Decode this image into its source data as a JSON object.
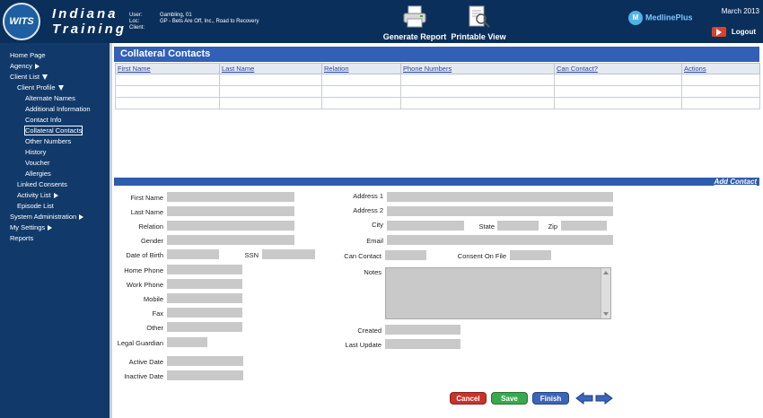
{
  "header": {
    "logo_text": "WITS",
    "brand_line1": "Indiana",
    "brand_line2": "Training",
    "info": [
      {
        "label": "User:",
        "value": "Gambling, 01"
      },
      {
        "label": "Loc:",
        "value": "GP - Bets Are Off, Inc., Road to Recovery"
      },
      {
        "label": "Client:",
        "value": ""
      }
    ],
    "generate_report_label": "Generate Report",
    "printable_view_label": "Printable View",
    "medline_label": "MedlinePlus",
    "date": "March 2013",
    "logout_label": "Logout"
  },
  "sidebar": {
    "items": [
      {
        "label": "Home Page"
      },
      {
        "label": "Agency"
      },
      {
        "label": "Client List"
      },
      {
        "label": "Client Profile"
      },
      {
        "label": "Alternate Names"
      },
      {
        "label": "Additional Information"
      },
      {
        "label": "Contact Info"
      },
      {
        "label": "Collateral Contacts"
      },
      {
        "label": "Other Numbers"
      },
      {
        "label": "History"
      },
      {
        "label": "Voucher"
      },
      {
        "label": "Allergies"
      },
      {
        "label": "Linked Consents"
      },
      {
        "label": "Activity List"
      },
      {
        "label": "Episode List"
      },
      {
        "label": "System Administration"
      },
      {
        "label": "My Settings"
      },
      {
        "label": "Reports"
      }
    ]
  },
  "main": {
    "title": "Collateral Contacts",
    "columns": [
      "First Name",
      "Last Name",
      "Relation",
      "Phone Numbers",
      "Can Contact?",
      "Actions"
    ],
    "add_contact_label": "Add Contact",
    "form": {
      "first_name": "First Name",
      "last_name": "Last Name",
      "relation": "Relation",
      "gender": "Gender",
      "dob": "Date of Birth",
      "ssn": "SSN",
      "home_phone": "Home Phone",
      "work_phone": "Work Phone",
      "mobile": "Mobile",
      "fax": "Fax",
      "other": "Other",
      "legal_guardian": "Legal Guardian",
      "active_date": "Active Date",
      "inactive_date": "Inactive Date",
      "address1": "Address 1",
      "address2": "Address 2",
      "city": "City",
      "state": "State",
      "zip": "Zip",
      "email": "Email",
      "can_contact": "Can Contact",
      "consent_on_file": "Consent On File",
      "notes": "Notes",
      "created": "Created",
      "last_update": "Last Update"
    },
    "buttons": {
      "cancel": "Cancel",
      "save": "Save",
      "finish": "Finish"
    }
  }
}
